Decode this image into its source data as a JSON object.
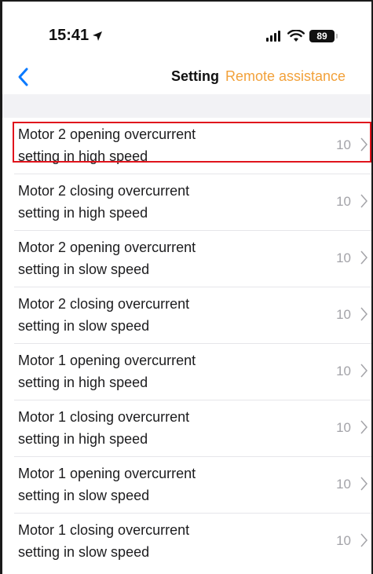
{
  "status_bar": {
    "time": "15:41",
    "battery": "89",
    "icons": [
      "location-arrow-icon",
      "cellular-signal-icon",
      "wifi-icon",
      "battery-icon"
    ]
  },
  "nav": {
    "title": "Setting",
    "action": "Remote assistance",
    "accent_color": "#f2a13a",
    "back_color": "#0a7aff"
  },
  "settings": [
    {
      "line1": "Motor 2 opening overcurrent",
      "line2": "setting in high speed",
      "value": "10"
    },
    {
      "line1": "Motor 2 closing overcurrent",
      "line2": "setting in high speed",
      "value": "10"
    },
    {
      "line1": "Motor 2 opening overcurrent",
      "line2": "setting in slow speed",
      "value": "10"
    },
    {
      "line1": "Motor 2 closing overcurrent",
      "line2": "setting in slow speed",
      "value": "10"
    },
    {
      "line1": "Motor 1 opening overcurrent",
      "line2": "setting in high speed",
      "value": "10"
    },
    {
      "line1": "Motor 1 closing overcurrent",
      "line2": "setting in high speed",
      "value": "10"
    },
    {
      "line1": "Motor 1 opening overcurrent",
      "line2": "setting in slow speed",
      "value": "10"
    },
    {
      "line1": "Motor 1 closing overcurrent",
      "line2": "setting in slow speed",
      "value": "10"
    }
  ],
  "highlight_color": "#e0141c"
}
